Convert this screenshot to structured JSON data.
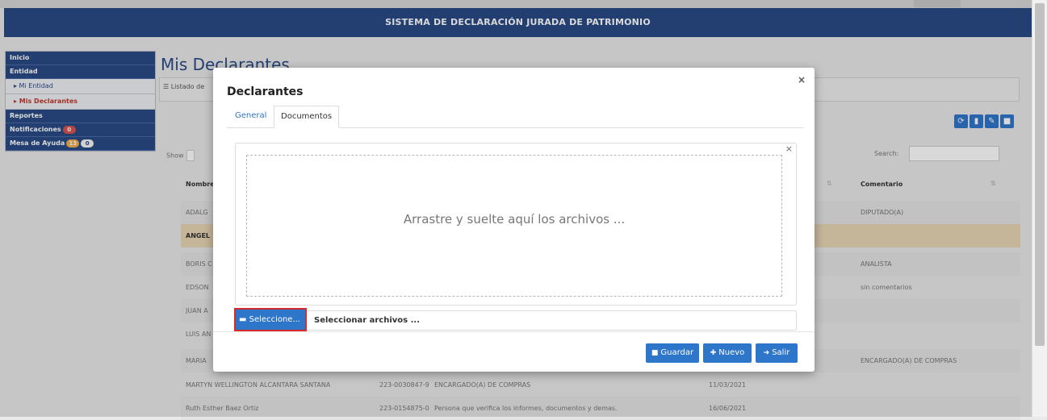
{
  "header": {
    "title": "SISTEMA DE DECLARACIÓN JURADA DE PATRIMONIO"
  },
  "sidebar": {
    "items": [
      {
        "label": "Inicio"
      },
      {
        "label": "Entidad"
      },
      {
        "label": "▸ Mi Entidad"
      },
      {
        "label": "▸ Mis Declarantes"
      },
      {
        "label": "Reportes"
      },
      {
        "label": "Notificaciones",
        "badge": "0"
      },
      {
        "label": "Mesa de Ayuda",
        "badge1": "13",
        "badge2": "0"
      }
    ]
  },
  "main": {
    "title": "Mis Declarantes",
    "panel_heading": "☰ Listado de",
    "show_label": "Show",
    "search_label": "Search:",
    "table": {
      "headers": [
        "Nombre",
        "Comentario"
      ],
      "rows": [
        {
          "name": "ADALG",
          "id": "",
          "cargo": "",
          "fecha": "",
          "comentario": "DIPUTADO(A)"
        },
        {
          "name": "ANGEL",
          "id": "",
          "cargo": "",
          "fecha": "",
          "comentario": ""
        },
        {
          "name": "BORIS C",
          "id": "",
          "cargo": "",
          "fecha": "",
          "comentario": "ANALISTA"
        },
        {
          "name": "EDSON",
          "id": "",
          "cargo": "",
          "fecha": "",
          "comentario": "sin comentarios"
        },
        {
          "name": "JUAN A",
          "id": "",
          "cargo": "",
          "fecha": "",
          "comentario": ""
        },
        {
          "name": "LUIS AN",
          "id": "",
          "cargo": "",
          "fecha": "",
          "comentario": ""
        },
        {
          "name": "MARIA",
          "id": "",
          "cargo": "",
          "fecha": "",
          "comentario": "ENCARGADO(A) DE COMPRAS"
        },
        {
          "name": "MARTYN WELLINGTON ALCANTARA SANTANA",
          "id": "223-0030847-9",
          "cargo": "ENCARGADO(A) DE COMPRAS",
          "fecha": "11/03/2021",
          "comentario": ""
        },
        {
          "name": "Ruth Esther Baez Ortiz",
          "id": "223-0154875-0",
          "cargo": "Persona que verifica los informes, documentos y demas.",
          "fecha": "16/06/2021",
          "comentario": ""
        }
      ]
    }
  },
  "modal": {
    "title": "Declarantes",
    "tabs": [
      "General",
      "Documentos"
    ],
    "drop_text": "Arrastre y suelte aquí los archivos ...",
    "select_button": "Seleccione...",
    "file_placeholder": "Seleccionar archivos ...",
    "buttons": {
      "save": "Guardar",
      "new": "Nuevo",
      "exit": "Salir"
    }
  },
  "colors": {
    "primary": "#2a4a86",
    "button": "#2e76c9",
    "highlight_outline": "#d62b2b",
    "row_highlight": "#e8d6b4"
  }
}
